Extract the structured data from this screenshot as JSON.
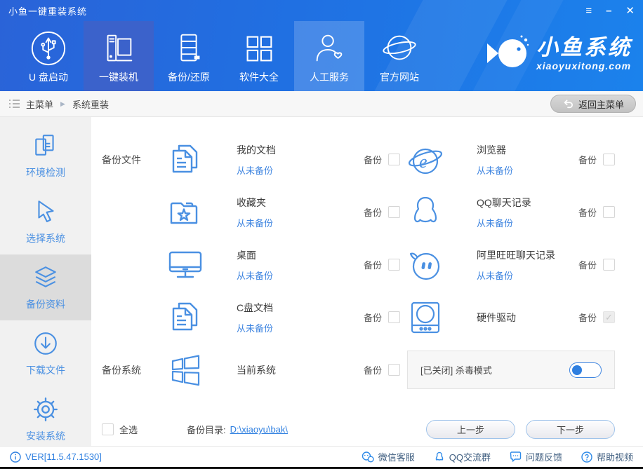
{
  "window": {
    "title": "小鱼一键重装系统"
  },
  "titlebar": {
    "controls": {
      "menu": "≡",
      "minimize": "–",
      "close": "✕"
    }
  },
  "nav": {
    "items": [
      {
        "label": "U 盘启动",
        "icon": "usb-icon",
        "state": "normal"
      },
      {
        "label": "一键装机",
        "icon": "computer-icon",
        "state": "active"
      },
      {
        "label": "备份/还原",
        "icon": "server-icon",
        "state": "normal"
      },
      {
        "label": "软件大全",
        "icon": "grid-icon",
        "state": "normal"
      },
      {
        "label": "人工服务",
        "icon": "support-person-icon",
        "state": "highlight"
      },
      {
        "label": "官方网站",
        "icon": "globe-icon",
        "state": "normal"
      }
    ],
    "logo": {
      "icon": "fish-icon",
      "title": "小鱼系统",
      "subtitle": "xiaoyuxitong.com"
    }
  },
  "breadcrumb": {
    "root": "主菜单",
    "arrow": "▶",
    "current": "系统重装",
    "back_button": "返回主菜单"
  },
  "sidebar": {
    "items": [
      {
        "label": "环境检测",
        "icon": "env-check-icon",
        "active": false
      },
      {
        "label": "选择系统",
        "icon": "cursor-icon",
        "active": false
      },
      {
        "label": "备份资料",
        "icon": "layers-icon",
        "active": true
      },
      {
        "label": "下载文件",
        "icon": "download-icon",
        "active": false
      },
      {
        "label": "安装系统",
        "icon": "gear-icon",
        "active": false
      }
    ]
  },
  "backup_files": {
    "section_label": "备份文件",
    "backup_label": "备份",
    "items": [
      {
        "name": "我的文档",
        "status": "从未备份",
        "icon": "documents-icon",
        "checked": false
      },
      {
        "name": "浏览器",
        "status": "从未备份",
        "icon": "browser-icon",
        "checked": false
      },
      {
        "name": "收藏夹",
        "status": "从未备份",
        "icon": "folder-star-icon",
        "checked": false
      },
      {
        "name": "QQ聊天记录",
        "status": "从未备份",
        "icon": "qq-icon",
        "checked": false
      },
      {
        "name": "桌面",
        "status": "从未备份",
        "icon": "monitor-icon",
        "checked": false
      },
      {
        "name": "阿里旺旺聊天记录",
        "status": "从未备份",
        "icon": "wangwang-icon",
        "checked": false
      },
      {
        "name": "C盘文档",
        "status": "从未备份",
        "icon": "documents-icon",
        "checked": false
      },
      {
        "name": "硬件驱动",
        "status": "",
        "icon": "hard-drive-icon",
        "checked": true,
        "disabled": true
      }
    ]
  },
  "backup_system": {
    "section_label": "备份系统",
    "item": {
      "name": "当前系统",
      "icon": "windows-icon",
      "checked": false
    }
  },
  "antivirus": {
    "label": "[已关闭] 杀毒模式",
    "toggle_state": "off"
  },
  "bottom": {
    "select_all_label": "全选",
    "dir_label": "备份目录:",
    "dir_value": "D:\\xiaoyu\\bak\\",
    "prev_button": "上一步",
    "next_button": "下一步"
  },
  "footer": {
    "version": "VER[11.5.47.1530]",
    "links": [
      {
        "label": "微信客服",
        "icon": "wechat-icon"
      },
      {
        "label": "QQ交流群",
        "icon": "qq-icon"
      },
      {
        "label": "问题反馈",
        "icon": "feedback-icon"
      },
      {
        "label": "帮助视频",
        "icon": "help-icon"
      }
    ]
  }
}
